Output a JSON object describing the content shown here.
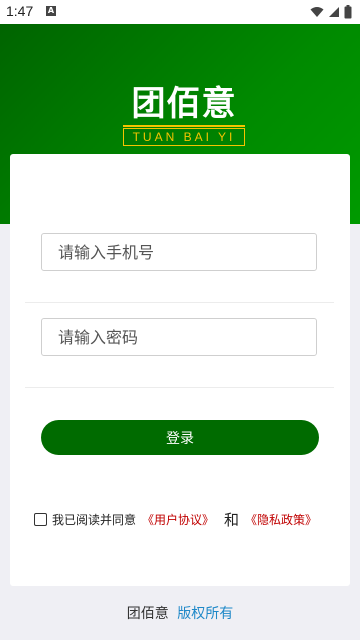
{
  "status_bar": {
    "time": "1:47",
    "notification_icon": "a-notification-icon",
    "icons": [
      "wifi-icon",
      "signal-icon",
      "battery-icon"
    ]
  },
  "logo": {
    "title": "团佰意",
    "subtitle": "TUAN BAI YI"
  },
  "login_form": {
    "phone_placeholder": "请输入手机号",
    "password_placeholder": "请输入密码",
    "login_label": "登录",
    "agree_text": "我已阅读并同意",
    "user_agreement": "《用户协议》",
    "and_text": "和",
    "privacy_policy": "《隐私政策》"
  },
  "footer": {
    "app_name": "团佰意",
    "rights": "版权所有"
  },
  "colors": {
    "brand_green": "#006b00",
    "header_green": "#008a00",
    "logo_gold": "#f5c400",
    "link_red": "#c00000",
    "footer_link": "#1e88c8"
  }
}
